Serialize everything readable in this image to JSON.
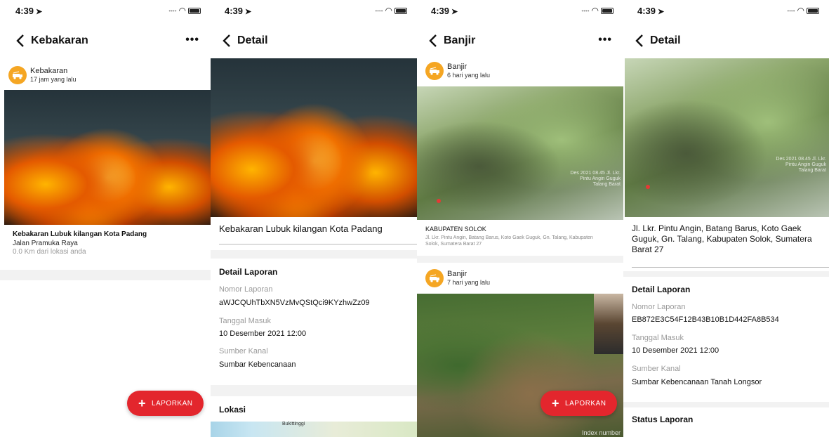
{
  "status": {
    "time": "4:39",
    "location_icon": "location-arrow-icon"
  },
  "screen1": {
    "nav_title": "Kebakaran",
    "post": {
      "category": "Kebakaran",
      "time_ago": "17 jam yang lalu",
      "title": "Kebakaran Lubuk kilangan Kota Padang",
      "street": "Jalan Pramuka Raya",
      "distance": "0.0 Km dari lokasi anda"
    },
    "fab_label": "LAPORKAN"
  },
  "screen2": {
    "nav_title": "Detail",
    "title": "Kebakaran Lubuk kilangan Kota Padang",
    "section_detail": "Detail Laporan",
    "nomor_label": "Nomor Laporan",
    "nomor_value": "aWJCQUhTbXN5VzMvQStQci9KYzhwZz09",
    "tanggal_label": "Tanggal Masuk",
    "tanggal_value": "10 Desember 2021 12:00",
    "sumber_label": "Sumber Kanal",
    "sumber_value": "Sumbar Kebencanaan",
    "section_lokasi": "Lokasi",
    "map_label": "Bukittinggi"
  },
  "screen3": {
    "nav_title": "Banjir",
    "post1": {
      "category": "Banjir",
      "time_ago": "6 hari yang lalu",
      "title": "KABUPATEN SOLOK",
      "address": "Jl. Lkr. Pintu Angin, Batang Barus, Koto Gaek Guguk, Gn. Talang, Kabupaten Solok, Sumatera Barat 27"
    },
    "post2": {
      "category": "Banjir",
      "time_ago": "7 hari yang lalu",
      "watermark": "Index number"
    },
    "fab_label": "LAPORKAN",
    "img_watermark": "Des 2021 08.45 Jl. Lkr. Pintu Angin Guguk Talang Barat"
  },
  "screen4": {
    "nav_title": "Detail",
    "address": "Jl. Lkr. Pintu Angin, Batang Barus, Koto Gaek Guguk, Gn. Talang, Kabupaten Solok, Sumatera Barat 27",
    "section_detail": "Detail Laporan",
    "nomor_label": "Nomor Laporan",
    "nomor_value": "EB872E3C54F12B43B10B1D442FA8B534",
    "tanggal_label": "Tanggal Masuk",
    "tanggal_value": "10 Desember 2021 12:00",
    "sumber_label": "Sumber Kanal",
    "sumber_value": "Sumbar Kebencanaan Tanah Longsor",
    "section_status": "Status Laporan",
    "img_watermark": "Des 2021 08.45 Jl. Lkr. Pintu Angin Guguk Talang Barat"
  },
  "colors": {
    "accent": "#e3262d",
    "badge": "#f5a623"
  }
}
